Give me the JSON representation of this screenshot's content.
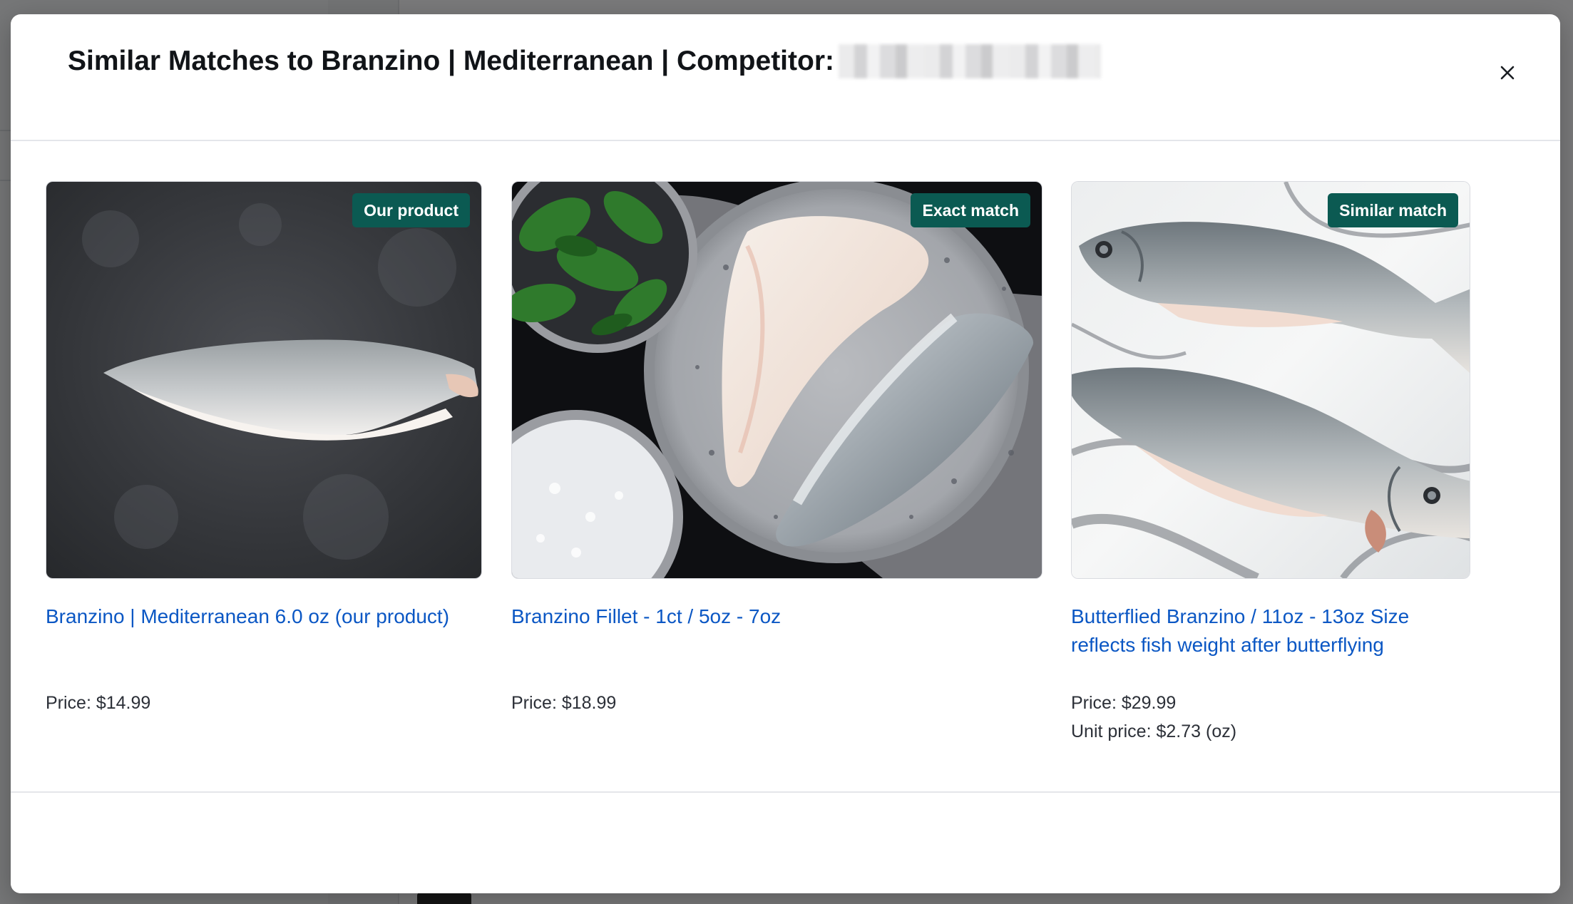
{
  "modal": {
    "title": "Similar Matches to Branzino | Mediterranean | Competitor:",
    "close_icon": "close-icon",
    "cards": [
      {
        "badge": "Our product",
        "title": "Branzino | Mediterranean 6.0 oz (our product)",
        "price": "Price: $14.99",
        "image": "fish-fillet-dark-stone-image"
      },
      {
        "badge": "Exact match",
        "title": "Branzino Fillet - 1ct / 5oz - 7oz",
        "price": "Price: $18.99",
        "image": "two-fillets-on-plate-image"
      },
      {
        "badge": "Similar match",
        "title": "Butterflied Branzino / 11oz - 13oz Size reflects fish weight after butterflying",
        "price": "Price: $29.99",
        "unit_price": "Unit price: $2.73 (oz)",
        "image": "two-whole-fish-marble-image"
      }
    ]
  },
  "colors": {
    "badge_bg": "#0b5a52",
    "link": "#0b57c4",
    "overlay": "rgba(0,0,0,0.5)"
  }
}
